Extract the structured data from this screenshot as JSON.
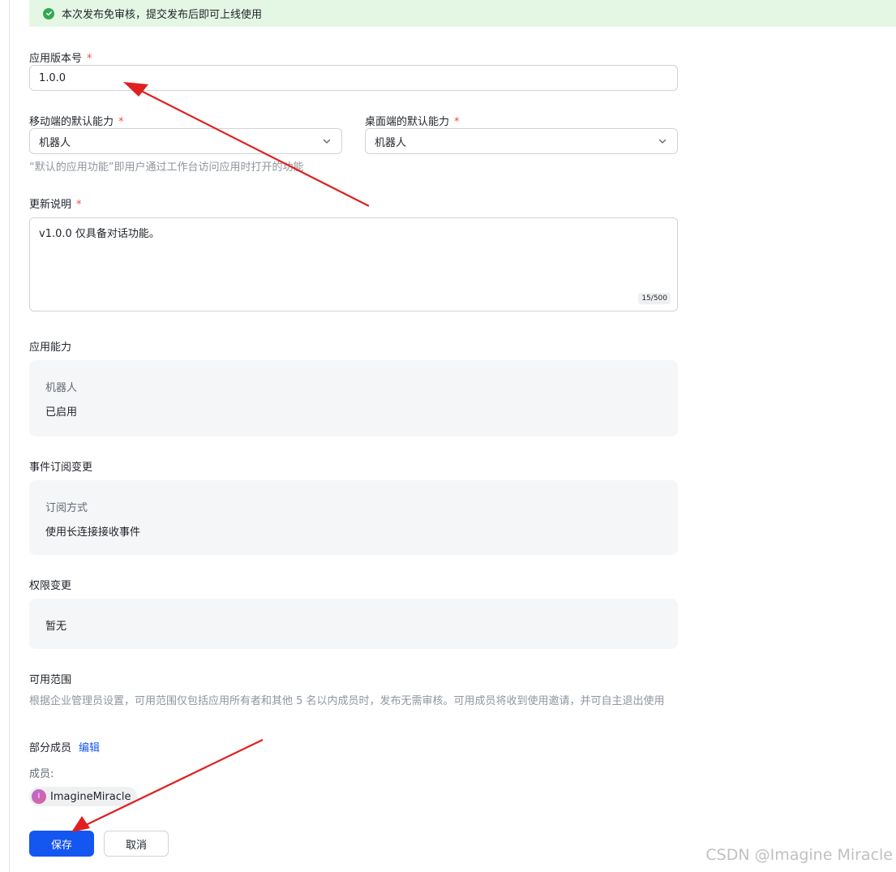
{
  "banner": {
    "text": "本次发布免审核，提交发布后即可上线使用"
  },
  "version": {
    "label": "应用版本号",
    "required_mark": "*",
    "value": "1.0.0"
  },
  "mobile_default": {
    "label": "移动端的默认能力",
    "required_mark": "*",
    "value": "机器人"
  },
  "desktop_default": {
    "label": "桌面端的默认能力",
    "required_mark": "*",
    "value": "机器人"
  },
  "default_hint": "“默认的应用功能”即用户通过工作台访问应用时打开的功能",
  "release_notes": {
    "label": "更新说明",
    "required_mark": "*",
    "value": "v1.0.0 仅具备对话功能。",
    "counter": "15/500"
  },
  "capabilities": {
    "heading": "应用能力",
    "key": "机器人",
    "value": "已启用"
  },
  "event_subscription": {
    "heading": "事件订阅变更",
    "key": "订阅方式",
    "value": "使用长连接接收事件"
  },
  "permissions": {
    "heading": "权限变更",
    "value": "暂无"
  },
  "availability": {
    "heading": "可用范围",
    "description": "根据企业管理员设置，可用范围仅包括应用所有者和其他 5 名以内成员时，发布无需审核。可用成员将收到使用邀请，并可自主退出使用",
    "scope_label": "部分成员",
    "edit_label": "编辑",
    "members_label": "成员:",
    "members": [
      {
        "initial": "I",
        "name": "ImagineMiracle"
      }
    ]
  },
  "actions": {
    "save_label": "保存",
    "cancel_label": "取消"
  },
  "watermark": "CSDN @Imagine Miracle",
  "colors": {
    "primary": "#1456f0",
    "success": "#34a853",
    "required": "#f54a45",
    "annotation_arrow": "#e02020"
  },
  "icons": {
    "banner": "check-circle-icon",
    "select": "chevron-down-icon"
  }
}
